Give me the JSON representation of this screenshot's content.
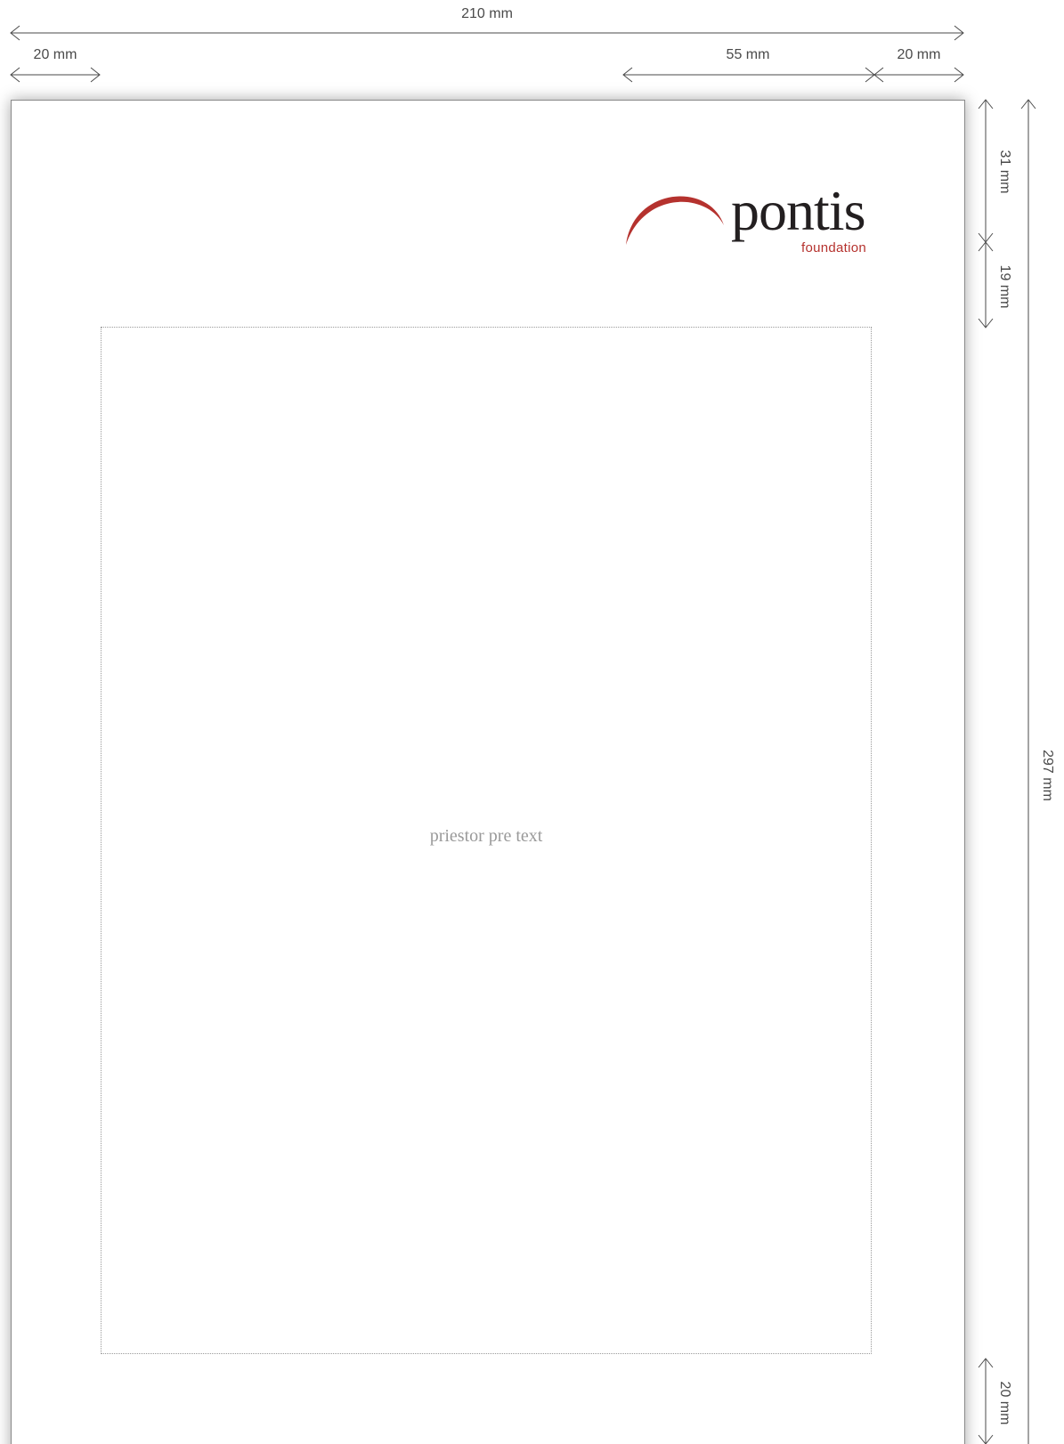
{
  "dimensions": {
    "total_width": "210 mm",
    "left_margin": "20 mm",
    "logo_width": "55 mm",
    "right_margin": "20 mm",
    "top_offset": "31 mm",
    "logo_gap": "19 mm",
    "bottom_margin": "20 mm",
    "total_height": "297 mm"
  },
  "logo": {
    "name": "pontis",
    "subtitle": "foundation",
    "accent_color": "#b5322e",
    "text_color": "#231f20"
  },
  "content": {
    "placeholder": "priestor pre text"
  }
}
